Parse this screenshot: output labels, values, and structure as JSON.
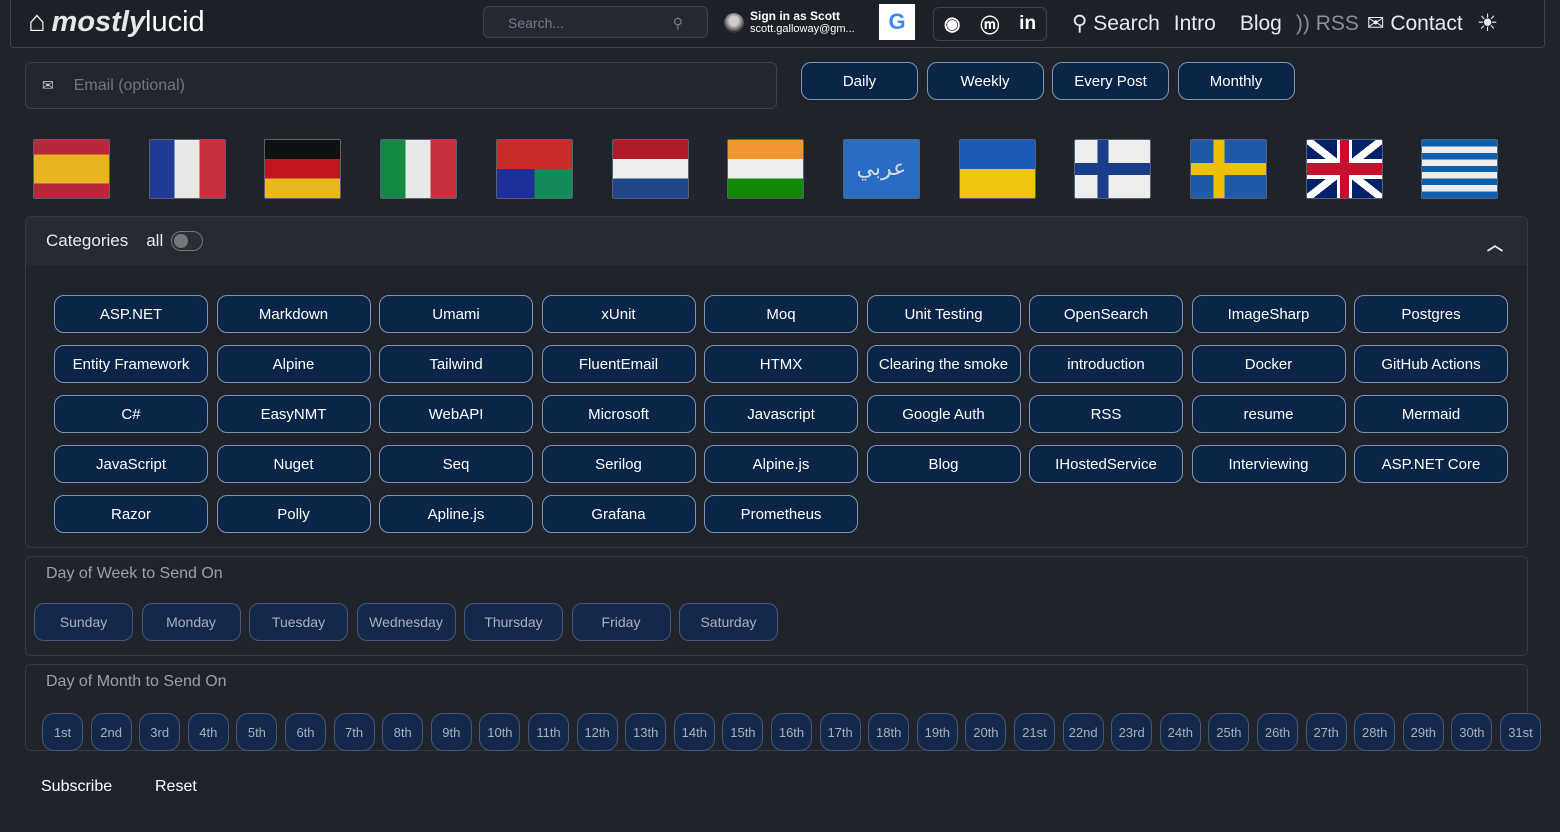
{
  "nav": {
    "logo_bold": "mostly",
    "logo_light": "lucid",
    "search_placeholder": "Search...",
    "user_line1": "Sign in as Scott",
    "user_line2": "scott.galloway@gm...",
    "google_letter": "G",
    "links": [
      {
        "icon": "search-icon",
        "label": "Search"
      },
      {
        "label": "Intro"
      },
      {
        "label": "Blog"
      },
      {
        "icon": "rss-icon",
        "label": "RSS"
      },
      {
        "icon": "contact-icon",
        "label": "Contact"
      }
    ]
  },
  "email": {
    "placeholder": "Email (optional)"
  },
  "frequency": [
    "Daily",
    "Weekly",
    "Every Post",
    "Monthly"
  ],
  "flags": [
    "spain",
    "france",
    "germany",
    "italy",
    "chinese",
    "netherlands",
    "india",
    "arabic",
    "ukraine",
    "finland",
    "sweden",
    "uk",
    "greece"
  ],
  "arabic_flag_text": "عربي",
  "categories": {
    "title": "Categories",
    "all_label": "all",
    "all_on": false,
    "items": [
      "ASP.NET",
      "Markdown",
      "Umami",
      "xUnit",
      "Moq",
      "Unit Testing",
      "OpenSearch",
      "ImageSharp",
      "Postgres",
      "Entity Framework",
      "Alpine",
      "Tailwind",
      "FluentEmail",
      "HTMX",
      "Clearing the smoke",
      "introduction",
      "Docker",
      "GitHub Actions",
      "C#",
      "EasyNMT",
      "WebAPI",
      "Microsoft",
      "Javascript",
      "Google Auth",
      "RSS",
      "resume",
      "Mermaid",
      "JavaScript",
      "Nuget",
      "Seq",
      "Serilog",
      "Alpine.js",
      "Blog",
      "IHostedService",
      "Interviewing",
      "ASP.NET Core",
      "Razor",
      "Polly",
      "Apline.js",
      "Grafana",
      "Prometheus"
    ]
  },
  "week": {
    "title": "Day of Week to Send On",
    "days": [
      "Sunday",
      "Monday",
      "Tuesday",
      "Wednesday",
      "Thursday",
      "Friday",
      "Saturday"
    ]
  },
  "month": {
    "title": "Day of Month to Send On",
    "days": [
      "1st",
      "2nd",
      "3rd",
      "4th",
      "5th",
      "6th",
      "7th",
      "8th",
      "9th",
      "10th",
      "11th",
      "12th",
      "13th",
      "14th",
      "15th",
      "16th",
      "17th",
      "18th",
      "19th",
      "20th",
      "21st",
      "22nd",
      "23rd",
      "24th",
      "25th",
      "26th",
      "27th",
      "28th",
      "29th",
      "30th",
      "31st"
    ]
  },
  "actions": {
    "subscribe": "Subscribe",
    "reset": "Reset"
  },
  "colors": {
    "background": "#1f232b",
    "button": "#0b2548",
    "button_border": "#8494ad"
  }
}
